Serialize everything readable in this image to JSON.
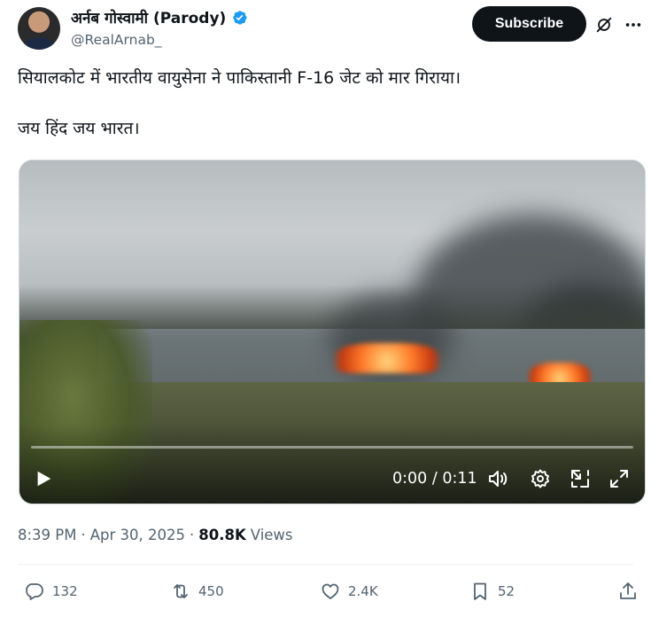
{
  "author": {
    "display_name": "अर्नब गोस्वामी (Parody)",
    "handle": "@RealArnab_",
    "verified": true,
    "avatar_icon": "profile-photo"
  },
  "header": {
    "subscribe_label": "Subscribe",
    "grok_icon": "grok-slash-icon",
    "more_icon": "more-horizontal-icon"
  },
  "tweet": {
    "line1": "सियालकोट में भारतीय वायुसेना ने पाकिस्तानी F-16 जेट को मार गिराया।",
    "line2": "जय हिंद जय भारत।",
    "emoji": "india-flag-icon"
  },
  "video": {
    "time": "0:00 / 0:11",
    "progress": 0,
    "controls": [
      "play-icon",
      "volume-icon",
      "settings-icon",
      "picture-in-picture-icon",
      "fullscreen-icon"
    ]
  },
  "meta": {
    "time": "8:39 PM",
    "separator": "·",
    "date": "Apr 30, 2025",
    "views_count": "80.8K",
    "views_label": "Views"
  },
  "actions": {
    "replies": "132",
    "reposts": "450",
    "likes": "2.4K",
    "bookmarks": "52"
  },
  "colors": {
    "accent": "#1d9bf0",
    "text_primary": "#0f1419",
    "text_secondary": "#536471",
    "button_bg": "#0f1419"
  }
}
